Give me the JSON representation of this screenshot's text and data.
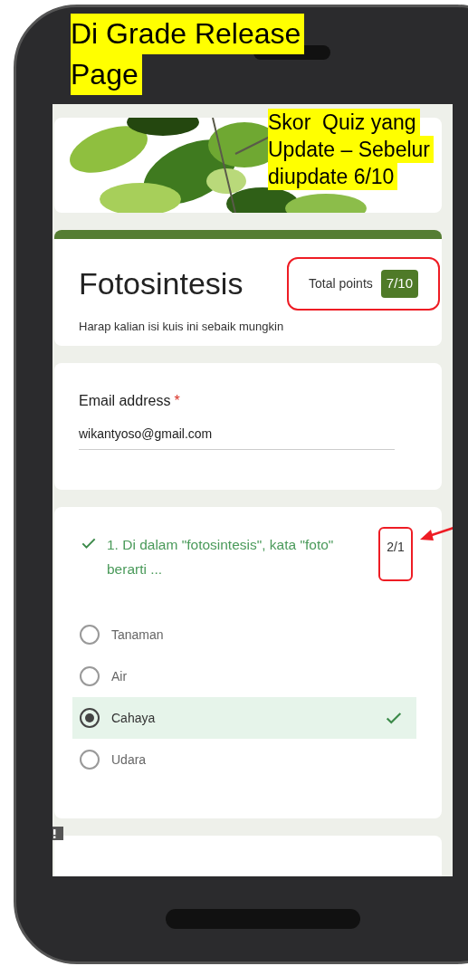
{
  "annotations": [
    {
      "lines": [
        "Di Grade Release",
        "Page"
      ],
      "kind": "page"
    },
    {
      "lines": [
        "Skor  Quiz yang",
        "Update – Sebelur",
        "diupdate 6/10"
      ],
      "kind": "score"
    }
  ],
  "form": {
    "title": "Fotosintesis",
    "total_points_label": "Total points",
    "score": "7/10",
    "score_highlighted": true,
    "description": "Harap kalian isi kuis ini sebaik mungkin"
  },
  "email": {
    "label": "Email address",
    "required": true,
    "required_mark": "*",
    "value": "wikantyoso@gmail.com"
  },
  "question": {
    "correct": true,
    "text": "1. Di dalam \"fotosintesis\", kata \"foto\" berarti ...",
    "points": "2/1",
    "points_highlighted": true,
    "options": [
      {
        "label": "Tanaman",
        "selected": false,
        "correct": false
      },
      {
        "label": "Air",
        "selected": false,
        "correct": false
      },
      {
        "label": "Cahaya",
        "selected": true,
        "correct": true
      },
      {
        "label": "Udara",
        "selected": false,
        "correct": false
      }
    ]
  },
  "next_card": {
    "feedback_flag": true
  }
}
